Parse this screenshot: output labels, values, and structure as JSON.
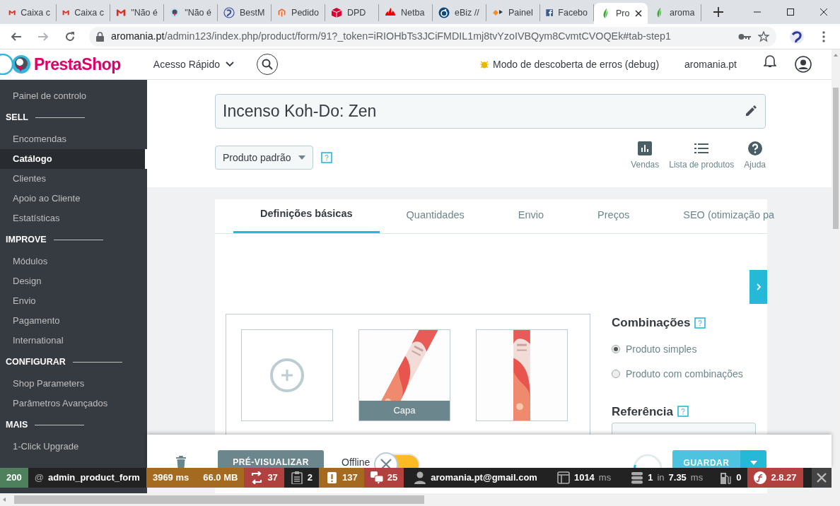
{
  "browser_tabs": [
    {
      "title": "Caixa c",
      "selected": false
    },
    {
      "title": "Caixa c",
      "selected": false
    },
    {
      "title": "\"Não é",
      "selected": false
    },
    {
      "title": "\"Não é",
      "selected": false
    },
    {
      "title": "BestM",
      "selected": false
    },
    {
      "title": "Pedido",
      "selected": false
    },
    {
      "title": "DPD",
      "selected": false
    },
    {
      "title": "Netba",
      "selected": false
    },
    {
      "title": "eBiz //",
      "selected": false
    },
    {
      "title": "Painel",
      "selected": false
    },
    {
      "title": "Facebo",
      "selected": false
    },
    {
      "title": "Pro",
      "selected": true
    },
    {
      "title": "aroma",
      "selected": false
    }
  ],
  "address_bar": {
    "host": "aromania.pt",
    "path": "/admin123/index.php/product/form/91?_token=iRIOHbTs3JCiFMDIL1mj8tvYzoIVBQym8CvmtCVOQEk#tab-step1"
  },
  "header": {
    "logo": "PrestaShop",
    "quick_access": "Acesso Rápido",
    "debug_notice": "Modo de descoberta de erros (debug)",
    "shop_name": "aromania.pt"
  },
  "sidebar": {
    "items": [
      {
        "kind": "link",
        "label": "Painel de controlo",
        "selected": false
      },
      {
        "kind": "section",
        "label": "SELL"
      },
      {
        "kind": "link",
        "label": "Encomendas",
        "selected": false
      },
      {
        "kind": "link",
        "label": "Catálogo",
        "selected": true
      },
      {
        "kind": "link",
        "label": "Clientes",
        "selected": false
      },
      {
        "kind": "link",
        "label": "Apoio ao Cliente",
        "selected": false
      },
      {
        "kind": "link",
        "label": "Estatísticas",
        "selected": false
      },
      {
        "kind": "section",
        "label": "IMPROVE"
      },
      {
        "kind": "link",
        "label": "Módulos",
        "selected": false
      },
      {
        "kind": "link",
        "label": "Design",
        "selected": false
      },
      {
        "kind": "link",
        "label": "Envio",
        "selected": false
      },
      {
        "kind": "link",
        "label": "Pagamento",
        "selected": false
      },
      {
        "kind": "link",
        "label": "International",
        "selected": false
      },
      {
        "kind": "section",
        "label": "CONFIGURAR"
      },
      {
        "kind": "link",
        "label": "Shop Parameters",
        "selected": false
      },
      {
        "kind": "link",
        "label": "Parâmetros Avançados",
        "selected": false
      },
      {
        "kind": "section",
        "label": "MAIS"
      },
      {
        "kind": "link",
        "label": "1-Click Upgrade",
        "selected": false
      }
    ]
  },
  "product": {
    "name": "Incenso Koh-Do: Zen",
    "type": "Produto padrão",
    "toolbar": [
      {
        "label": "Vendas"
      },
      {
        "label": "Lista de produtos"
      },
      {
        "label": "Ajuda"
      }
    ],
    "tabs": [
      {
        "label": "Definições básicas",
        "selected": true
      },
      {
        "label": "Quantidades",
        "selected": false
      },
      {
        "label": "Envio",
        "selected": false
      },
      {
        "label": "Preços",
        "selected": false
      },
      {
        "label": "SEO (otimização pa",
        "selected": false
      }
    ],
    "images": [
      {
        "kind": "add"
      },
      {
        "kind": "picture",
        "caption": "Capa"
      },
      {
        "kind": "picture"
      }
    ],
    "combinations": {
      "title": "Combinações",
      "options": [
        {
          "label": "Produto simples",
          "selected": true
        },
        {
          "label": "Produto com combinações",
          "selected": false
        }
      ]
    },
    "reference": {
      "label": "Referência"
    }
  },
  "action_bar": {
    "preview": "PRÉ-VISUALIZAR",
    "online_label": "Offline",
    "online": false,
    "save": "GUARDAR"
  },
  "debug_toolbar": {
    "segments": [
      {
        "color": "#4f805d",
        "texts": [
          {
            "text": "200",
            "muted": false
          }
        ]
      },
      {
        "color": "#222222",
        "texts": [
          {
            "text": "@",
            "muted": true
          },
          {
            "text": "admin_product_form",
            "muted": false
          }
        ]
      },
      {
        "color": "#a46a1f",
        "texts": [
          {
            "text": "3969 ms",
            "muted": false
          },
          {
            "text": "66.0 MB",
            "muted": false
          }
        ]
      },
      {
        "color": "#b0413e",
        "texts": [
          {
            "text": "37",
            "muted": false
          }
        ]
      },
      {
        "color": "#222222",
        "texts": [
          {
            "text": "2",
            "muted": false
          }
        ]
      },
      {
        "color": "#a46a1f",
        "texts": [
          {
            "text": "137",
            "muted": false
          }
        ]
      },
      {
        "color": "#b0413e",
        "texts": [
          {
            "text": "25",
            "muted": false
          }
        ]
      },
      {
        "color": "#222222",
        "texts": [
          {
            "text": "aromania.pt@gmail.com",
            "muted": false
          }
        ]
      },
      {
        "color": "#222222",
        "texts": [
          {
            "text": "1014",
            "muted": false
          },
          {
            "text": "ms",
            "muted": true
          }
        ]
      },
      {
        "color": "#222222",
        "texts": [
          {
            "text": "1",
            "muted": false
          },
          {
            "text": "in",
            "muted": true
          },
          {
            "text": "7.35",
            "muted": false
          },
          {
            "text": "ms",
            "muted": true
          }
        ]
      },
      {
        "color": "#222222",
        "texts": [
          {
            "text": "0",
            "muted": false
          }
        ]
      },
      {
        "color": "#b0413e",
        "texts": [
          {
            "text": "2.8.27",
            "muted": false
          }
        ]
      }
    ]
  }
}
